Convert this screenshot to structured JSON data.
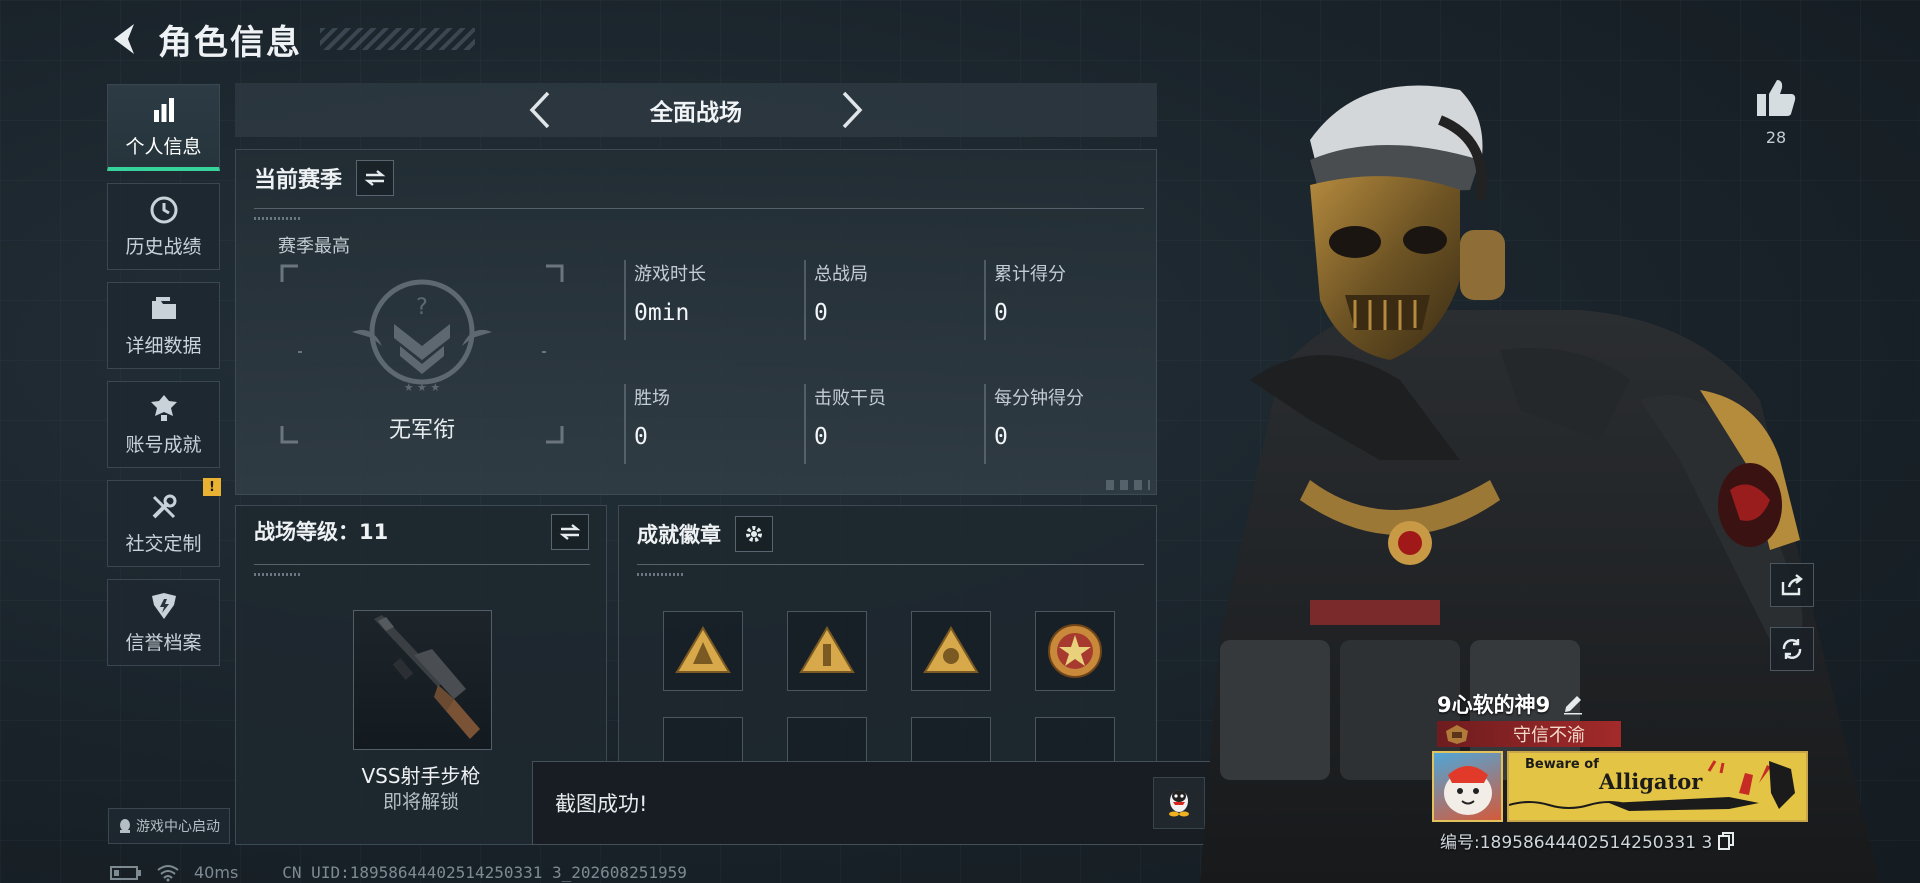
{
  "header": {
    "title": "角色信息"
  },
  "nav": {
    "items": [
      {
        "label": "个人信息",
        "icon": "bar-chart-icon",
        "active": true
      },
      {
        "label": "历史战绩",
        "icon": "clock-icon"
      },
      {
        "label": "详细数据",
        "icon": "folder-icon"
      },
      {
        "label": "账号成就",
        "icon": "medal-icon"
      },
      {
        "label": "社交定制",
        "icon": "tools-icon",
        "badge": "!"
      },
      {
        "label": "信誉档案",
        "icon": "shield-icon"
      }
    ],
    "game_center": "游戏中心启动"
  },
  "mode": {
    "title": "全面战场"
  },
  "season": {
    "title": "当前赛季",
    "best_label": "赛季最高",
    "rank_name": "无军衔",
    "stats": [
      {
        "label": "游戏时长",
        "value": "0min"
      },
      {
        "label": "总战局",
        "value": "0"
      },
      {
        "label": "累计得分",
        "value": "0"
      },
      {
        "label": "胜场",
        "value": "0"
      },
      {
        "label": "击败干员",
        "value": "0"
      },
      {
        "label": "每分钟得分",
        "value": "0"
      }
    ]
  },
  "level": {
    "title": "战场等级：11",
    "weapon_name": "VSS射手步枪",
    "weapon_status": "即将解锁"
  },
  "badges": {
    "title": "成就徽章",
    "items": [
      "triangle-badge-icon",
      "triangle-badge-icon",
      "triangle-badge-icon",
      "star-emblem-badge-icon",
      "",
      "",
      "",
      ""
    ]
  },
  "toast": {
    "text": "截图成功!"
  },
  "status": {
    "ping": "40ms",
    "uid": "CN UID:18958644402514250331 3_202608251959"
  },
  "like": {
    "count": "28"
  },
  "player": {
    "name": "9心软的神9",
    "title": "守信不渝",
    "banner_line1": "Beware of",
    "banner_line2": "Alligator",
    "id_text": "编号:18958644402514250331 3"
  },
  "colors": {
    "accent": "#36d49b",
    "badge_gold": "#d8a94a",
    "title_red": "#a32a2a"
  }
}
